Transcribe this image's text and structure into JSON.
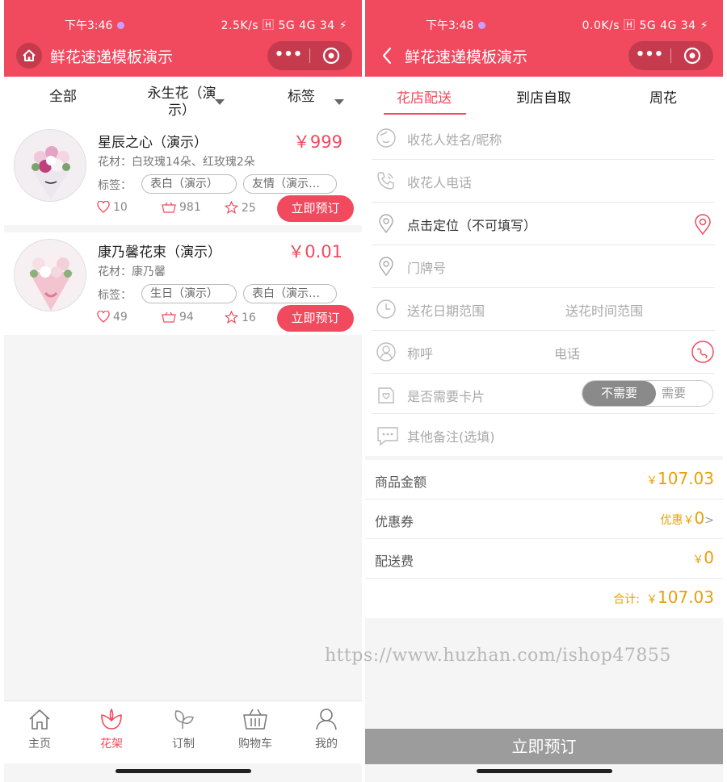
{
  "left": {
    "status": {
      "time": "下午3:46",
      "net": "2.5K/s 🄷 5G 4G 34 ⚡"
    },
    "title": "鲜花速递模板演示",
    "capsule": {
      "more": "•••"
    },
    "filters": [
      "全部",
      "永生花（演示）",
      "标签"
    ],
    "products": [
      {
        "name": "星辰之心（演示）",
        "price": "￥999",
        "material": "花材：白玫瑰14朵、红玫瑰2朵",
        "tag_label": "标签：",
        "tags": [
          "表白（演示）",
          "友情（演示…"
        ],
        "likes": "10",
        "sales": "981",
        "stars": "25",
        "button": "立即预订"
      },
      {
        "name": "康乃馨花束（演示）",
        "price": "￥0.01",
        "material": "花材：康乃馨",
        "tag_label": "标签：",
        "tags": [
          "生日（演示）",
          "表白（演示…"
        ],
        "likes": "49",
        "sales": "94",
        "stars": "16",
        "button": "立即预订"
      }
    ],
    "tabbar": [
      {
        "label": "主页",
        "icon": "home-icon"
      },
      {
        "label": "花架",
        "icon": "flower-icon"
      },
      {
        "label": "订制",
        "icon": "leaf-icon"
      },
      {
        "label": "购物车",
        "icon": "cart-icon"
      },
      {
        "label": "我的",
        "icon": "user-icon"
      }
    ]
  },
  "right": {
    "status": {
      "time": "下午3:48",
      "net": "0.0K/s 🄷 5G 4G 34 ⚡"
    },
    "title": "鲜花速递模板演示",
    "tabs": [
      "花店配送",
      "到店自取",
      "周花"
    ],
    "form": {
      "name_placeholder": "收花人姓名/昵称",
      "phone_placeholder": "收花人电话",
      "location": "点击定位（不可填写）",
      "door_placeholder": "门牌号",
      "date_placeholder": "送花日期范围",
      "time_placeholder": "送花时间范围",
      "title_placeholder": "称呼",
      "tel_placeholder": "电话",
      "card_label": "是否需要卡片",
      "card_no": "不需要",
      "card_yes": "需要",
      "remark_placeholder": "其他备注(选填)"
    },
    "summary": {
      "amount_label": "商品金额",
      "amount": "107.03",
      "coupon_label": "优惠券",
      "coupon_prefix": "优惠",
      "coupon": "0",
      "coupon_arrow": ">",
      "delivery_label": "配送费",
      "delivery": "0",
      "total_label": "合计:",
      "total": "107.03",
      "currency": "￥"
    },
    "book_button": "立即预订"
  },
  "watermark": "https://www.huzhan.com/ishop47855",
  "colors": {
    "brand": "#f1495e",
    "price_gold": "#e8a00a"
  }
}
